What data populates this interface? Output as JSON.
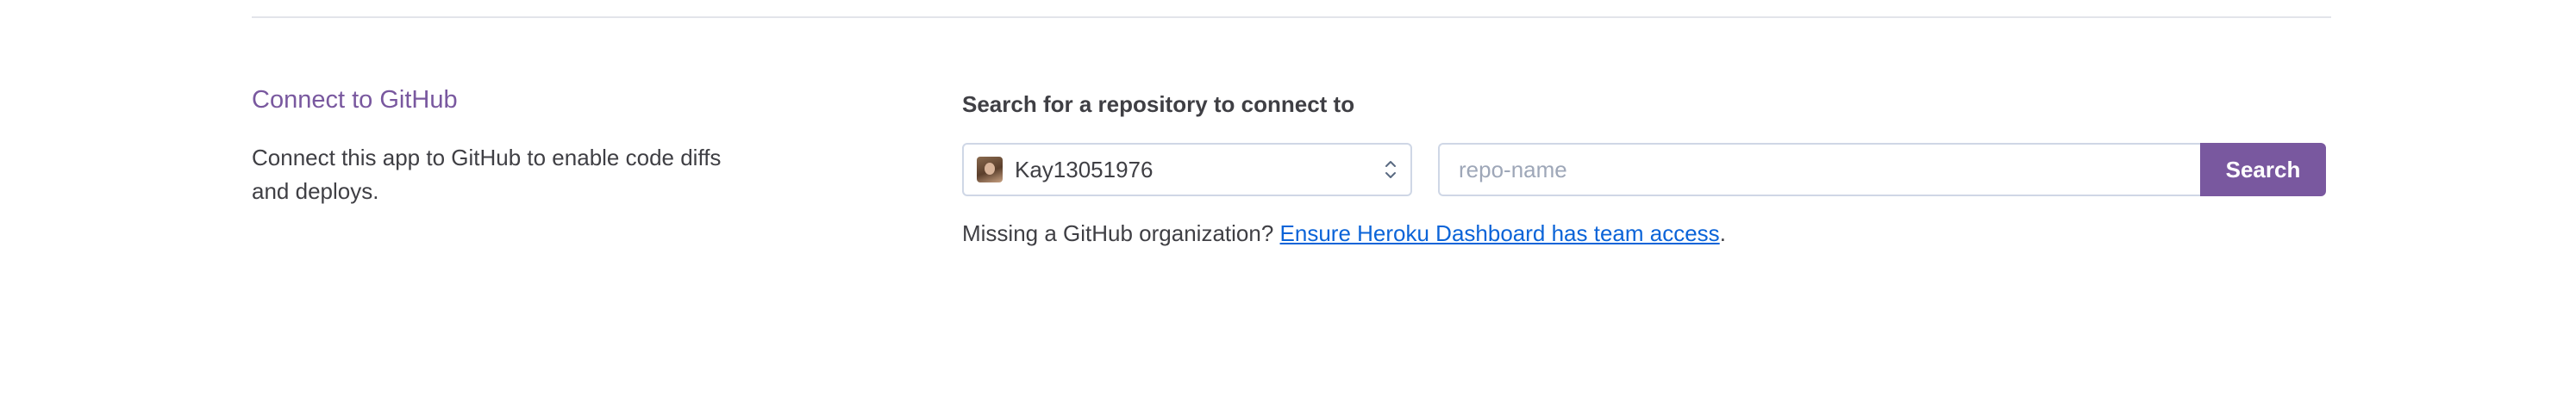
{
  "section": {
    "title": "Connect to GitHub",
    "description": "Connect this app to GitHub to enable code diffs and deploys."
  },
  "search": {
    "label": "Search for a repository to connect to",
    "org_selected": "Kay13051976",
    "org_icon": "user-avatar",
    "select_icon": "chevron-up-down-icon",
    "placeholder": "repo-name",
    "value": "",
    "button_label": "Search"
  },
  "help": {
    "text": "Missing a GitHub organization?",
    "link_text": "Ensure Heroku Dashboard has team access",
    "suffix": "."
  },
  "colors": {
    "accent": "#79589f",
    "link": "#0b64d8",
    "border": "#cfd7e6",
    "divider": "#e3e4ea"
  }
}
